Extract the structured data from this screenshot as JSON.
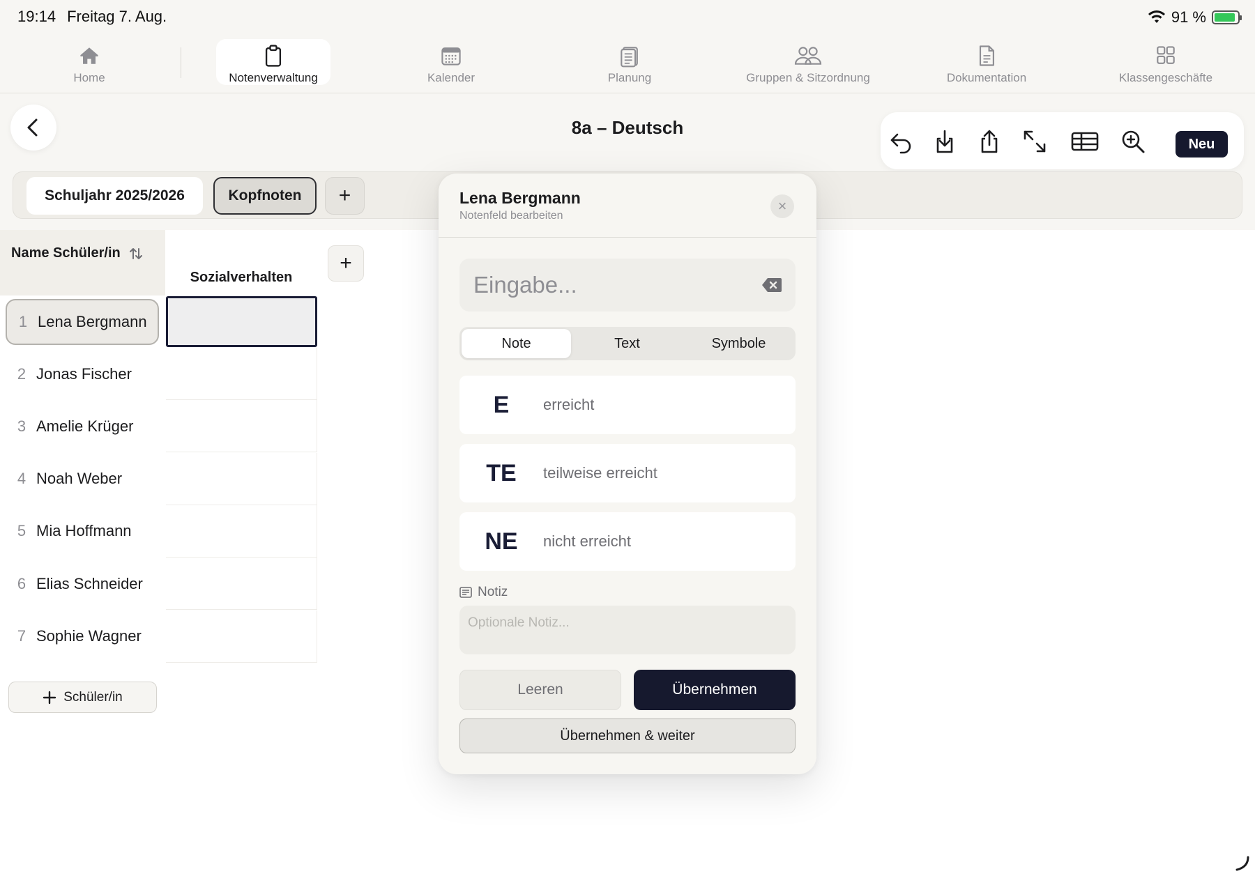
{
  "status_bar": {
    "time": "19:14",
    "date": "Freitag 7. Aug.",
    "battery": "91 %",
    "battery_level": 0.91
  },
  "tabs": [
    {
      "label": "Home",
      "icon": "house-icon"
    },
    {
      "label": "Notenverwaltung",
      "icon": "clipboard-icon",
      "active": true
    },
    {
      "label": "Kalender",
      "icon": "calendar-icon"
    },
    {
      "label": "Planung",
      "icon": "notepad-icon"
    },
    {
      "label": "Gruppen & Sitzordnung",
      "icon": "people-icon"
    },
    {
      "label": "Dokumentation",
      "icon": "document-icon"
    },
    {
      "label": "Klassengeschäfte",
      "icon": "grid-icon"
    }
  ],
  "header": {
    "title": "8a – Deutsch",
    "toolbar": [
      "undo-icon",
      "download-icon",
      "share-icon",
      "expand-icon",
      "table-icon",
      "zoom-in-icon"
    ],
    "new_label": "Neu"
  },
  "chips": {
    "year": "Schuljahr 2025/2026",
    "kopfnoten": "Kopfnoten",
    "add": "+"
  },
  "table": {
    "name_header": "Name Schüler/in",
    "column_header": "Sozialverhalten",
    "add_column": "+",
    "students": [
      {
        "num": "1",
        "name": "Lena Bergmann"
      },
      {
        "num": "2",
        "name": "Jonas Fischer"
      },
      {
        "num": "3",
        "name": "Amelie Krüger"
      },
      {
        "num": "4",
        "name": "Noah Weber"
      },
      {
        "num": "5",
        "name": "Mia Hoffmann"
      },
      {
        "num": "6",
        "name": "Elias Schneider"
      },
      {
        "num": "7",
        "name": "Sophie Wagner"
      }
    ],
    "add_student": "Schüler/in"
  },
  "sheet": {
    "title": "Lena Bergmann",
    "subtitle": "Notenfeld bearbeiten",
    "close": "×",
    "entry_placeholder": "Eingabe...",
    "segments": [
      "Note",
      "Text",
      "Symbole"
    ],
    "options": [
      {
        "code": "E",
        "desc": "erreicht"
      },
      {
        "code": "TE",
        "desc": "teilweise erreicht"
      },
      {
        "code": "NE",
        "desc": "nicht erreicht"
      }
    ],
    "note_label": "Notiz",
    "note_placeholder": "Optionale Notiz...",
    "clear_label": "Leeren",
    "apply_label": "Übernehmen",
    "apply_next_label": "Übernehmen & weiter"
  },
  "colors": {
    "accent": "#16192e",
    "background": "#f7f6f3",
    "battery": "#34c759"
  }
}
